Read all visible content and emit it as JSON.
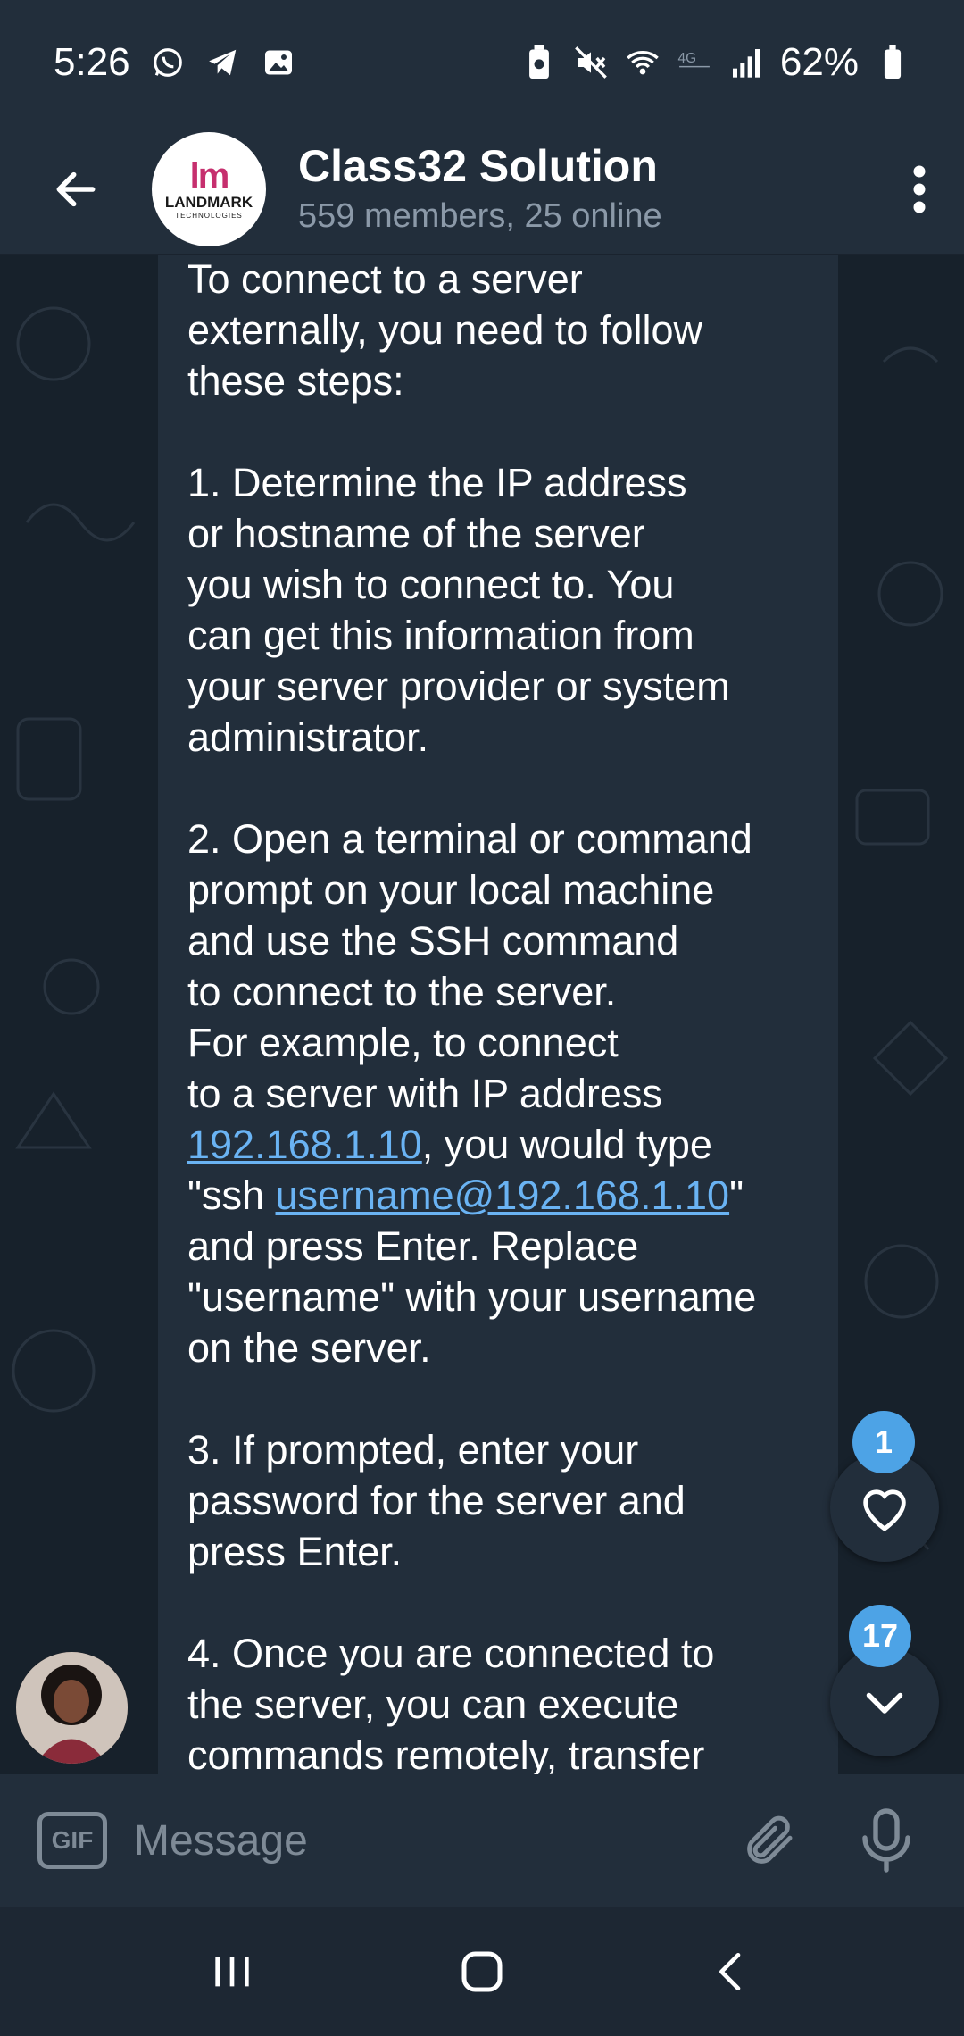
{
  "status_bar": {
    "time": "5:26",
    "battery": "62%",
    "icons_left": [
      "whatsapp-icon",
      "telegram-icon",
      "gallery-icon"
    ],
    "icons_right": [
      "battery-saver-icon",
      "mute-icon",
      "wifi-icon",
      "4g-icon",
      "signal-icon",
      "battery-icon"
    ]
  },
  "header": {
    "title": "Class32 Solution",
    "subtitle": "559 members, 25 online",
    "avatar": {
      "mark": "lm",
      "brand": "LANDMARK",
      "brand_sub": "TECHNOLOGIES"
    }
  },
  "message": {
    "intro": "To connect to a server\nexternally, you need to follow\nthese steps:",
    "step1": "1. Determine the IP address\nor hostname of the server\nyou wish to connect to. You\ncan get this information from\nyour server provider or system\nadministrator.",
    "step2_a": "2. Open a terminal or command\nprompt on your local machine\nand use the SSH command\nto connect to the server.\nFor example, to connect\nto a server with IP address",
    "step2_link1": "192.168.1.10",
    "step2_b": ", you would type",
    "step2_c": "\"ssh ",
    "step2_link2": "username@192.168.1.10",
    "step2_d": "\"",
    "step2_e": "and press Enter. Replace\n\"username\" with your username\non the server.",
    "step3": "3. If prompted, enter your\npassword for the server and\npress Enter.",
    "step4": "4. Once you are connected to\nthe server, you can execute\ncommands remotely, transfer"
  },
  "reactions": {
    "count": "1"
  },
  "scroll_down": {
    "unread": "17"
  },
  "input": {
    "gif_label": "GIF",
    "placeholder": "Message"
  },
  "colors": {
    "accent": "#6ab3f3",
    "badge": "#4da3e6",
    "bubble": "#222e3b",
    "background": "#17212b"
  }
}
